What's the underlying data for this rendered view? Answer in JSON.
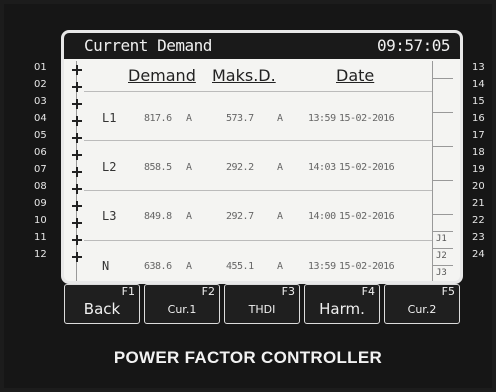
{
  "screen": {
    "title": "Current Demand",
    "clock": "09:57:05"
  },
  "row_numbers_left": [
    "01",
    "02",
    "03",
    "04",
    "05",
    "06",
    "07",
    "08",
    "09",
    "10",
    "11",
    "12"
  ],
  "row_numbers_right": [
    "13",
    "14",
    "15",
    "16",
    "17",
    "18",
    "19",
    "20",
    "21",
    "22",
    "23",
    "24"
  ],
  "table": {
    "headers": {
      "demand": "Demand",
      "max": "Maks.D.",
      "date": "Date"
    },
    "rows": [
      {
        "phase": "L1",
        "demand": "817.6",
        "demand_unit": "A",
        "max": "573.7",
        "max_unit": "A",
        "time": "13:59",
        "date": "15-02-2016"
      },
      {
        "phase": "L2",
        "demand": "858.5",
        "demand_unit": "A",
        "max": "292.2",
        "max_unit": "A",
        "time": "14:03",
        "date": "15-02-2016"
      },
      {
        "phase": "L3",
        "demand": "849.8",
        "demand_unit": "A",
        "max": "292.7",
        "max_unit": "A",
        "time": "14:00",
        "date": "15-02-2016"
      },
      {
        "phase": "N",
        "demand": "638.6",
        "demand_unit": "A",
        "max": "455.1",
        "max_unit": "A",
        "time": "13:59",
        "date": "15-02-2016"
      }
    ]
  },
  "right_labels": [
    "J1",
    "J2",
    "J3"
  ],
  "buttons": [
    {
      "fkey": "F1",
      "label": "Back"
    },
    {
      "fkey": "F2",
      "label": "Cur.1"
    },
    {
      "fkey": "F3",
      "label": "THDI"
    },
    {
      "fkey": "F4",
      "label": "Harm."
    },
    {
      "fkey": "F5",
      "label": "Cur.2"
    }
  ],
  "footer": "POWER FACTOR CONTROLLER"
}
